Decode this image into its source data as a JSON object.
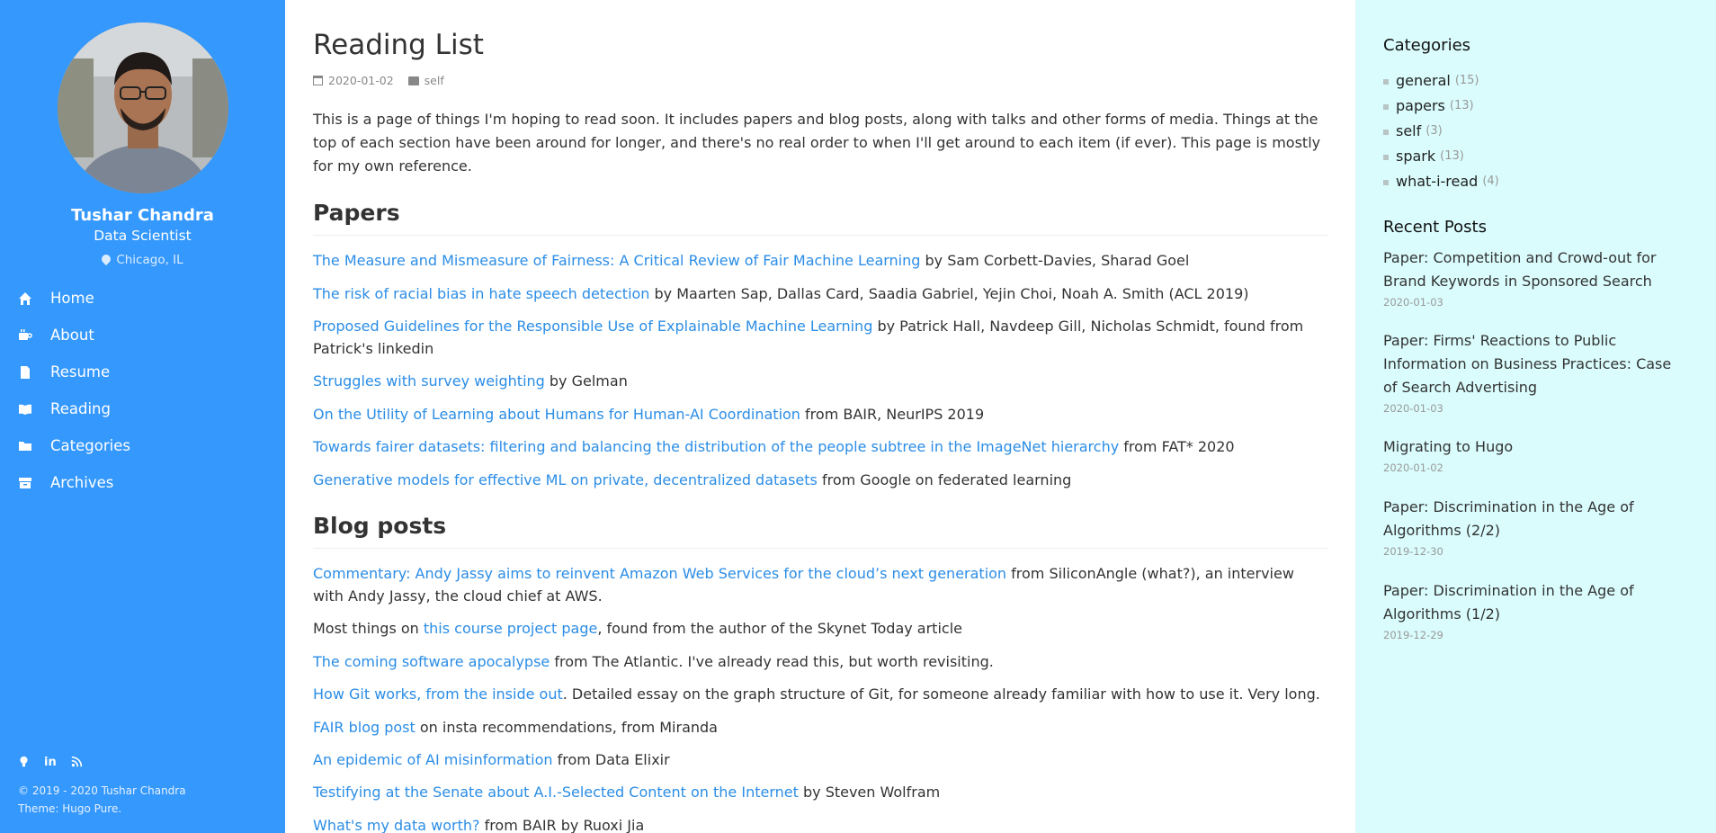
{
  "profile": {
    "name": "Tushar Chandra",
    "title": "Data Scientist",
    "location": "Chicago, IL"
  },
  "nav": [
    {
      "label": "Home",
      "icon": "home-icon"
    },
    {
      "label": "About",
      "icon": "coffee-icon"
    },
    {
      "label": "Resume",
      "icon": "file-icon"
    },
    {
      "label": "Reading",
      "icon": "book-icon"
    },
    {
      "label": "Categories",
      "icon": "folder-icon"
    },
    {
      "label": "Archives",
      "icon": "archive-icon"
    }
  ],
  "footer": {
    "copyright": "© 2019 - 2020 Tushar Chandra",
    "theme": "Theme: Hugo Pure."
  },
  "article": {
    "title": "Reading List",
    "date": "2020-01-02",
    "category": "self",
    "intro": "This is a page of things I'm hoping to read soon. It includes papers and blog posts, along with talks and other forms of media. Things at the top of each section have been around for longer, and there's no real order to when I'll get around to each item (if ever). This page is mostly for my own reference.",
    "papers_heading": "Papers",
    "papers": [
      {
        "link": "The Measure and Mismeasure of Fairness: A Critical Review of Fair Machine Learning",
        "rest": " by Sam Corbett-Davies, Sharad Goel"
      },
      {
        "link": "The risk of racial bias in hate speech detection",
        "rest": " by Maarten Sap, Dallas Card, Saadia Gabriel, Yejin Choi, Noah A. Smith (ACL 2019)"
      },
      {
        "link": "Proposed Guidelines for the Responsible Use of Explainable Machine Learning",
        "rest": " by Patrick Hall, Navdeep Gill, Nicholas Schmidt, found from Patrick's linkedin"
      },
      {
        "link": "Struggles with survey weighting",
        "rest": " by Gelman"
      },
      {
        "link": "On the Utility of Learning about Humans for Human-AI Coordination",
        "rest": " from BAIR, NeurIPS 2019"
      },
      {
        "link": "Towards fairer datasets: filtering and balancing the distribution of the people subtree in the ImageNet hierarchy",
        "rest": " from FAT* 2020"
      },
      {
        "link": "Generative models for effective ML on private, decentralized datasets",
        "rest": " from Google on federated learning"
      }
    ],
    "blog_heading": "Blog posts",
    "blog_posts": [
      {
        "pre": "",
        "link": "Commentary: Andy Jassy aims to reinvent Amazon Web Services for the cloud’s next generation",
        "rest": " from SiliconAngle (what?), an interview with Andy Jassy, the cloud chief at AWS."
      },
      {
        "pre": "Most things on ",
        "link": "this course project page",
        "rest": ", found from the author of the Skynet Today article"
      },
      {
        "pre": "",
        "link": "The coming software apocalypse",
        "rest": " from The Atlantic. I've already read this, but worth revisiting."
      },
      {
        "pre": "",
        "link": "How Git works, from the inside out",
        "rest": ". Detailed essay on the graph structure of Git, for someone already familiar with how to use it. Very long."
      },
      {
        "pre": "",
        "link": "FAIR blog post",
        "rest": " on insta recommendations, from Miranda"
      },
      {
        "pre": "",
        "link": "An epidemic of AI misinformation",
        "rest": " from Data Elixir"
      },
      {
        "pre": "",
        "link": "Testifying at the Senate about A.I.-Selected Content on the Internet",
        "rest": " by Steven Wolfram"
      },
      {
        "pre": "",
        "link": "What's my data worth?",
        "rest": " from BAIR by Ruoxi Jia"
      }
    ]
  },
  "sidebar_right": {
    "categories_title": "Categories",
    "categories": [
      {
        "name": "general",
        "count": "(15)"
      },
      {
        "name": "papers",
        "count": "(13)"
      },
      {
        "name": "self",
        "count": "(3)"
      },
      {
        "name": "spark",
        "count": "(13)"
      },
      {
        "name": "what-i-read",
        "count": "(4)"
      }
    ],
    "recent_title": "Recent Posts",
    "recent": [
      {
        "title": "Paper: Competition and Crowd-out for Brand Keywords in Sponsored Search",
        "date": "2020-01-03"
      },
      {
        "title": "Paper: Firms' Reactions to Public Information on Business Practices: Case of Search Advertising",
        "date": "2020-01-03"
      },
      {
        "title": "Migrating to Hugo",
        "date": "2020-01-02"
      },
      {
        "title": "Paper: Discrimination in the Age of Algorithms (2/2)",
        "date": "2019-12-30"
      },
      {
        "title": "Paper: Discrimination in the Age of Algorithms (1/2)",
        "date": "2019-12-29"
      }
    ]
  }
}
